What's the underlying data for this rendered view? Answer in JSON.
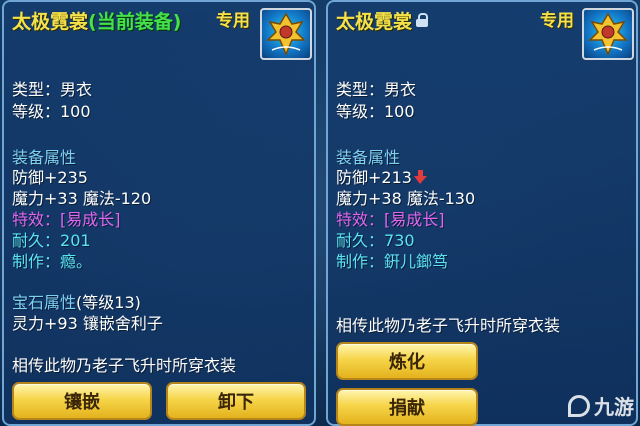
{
  "left": {
    "title": "太极霓裳",
    "title_suffix": "(当前装备)",
    "exclusive": "专用",
    "type_line": "类型：男衣",
    "level_line": "等级：100",
    "attr_header": "装备属性",
    "defense": "防御+235",
    "magic": "魔力+33 魔法-120",
    "effect_label": "特效：",
    "effect_value": "[易成长]",
    "durability_label": "耐久：",
    "durability_value": "201",
    "maker_label": "制作：",
    "maker_value": "瘾。",
    "gem_header": "宝石属性",
    "gem_level": "(等级13)",
    "gem_line": "灵力+93 镶嵌舍利子",
    "description": "相传此物乃老子飞升时所穿衣装",
    "buttons": {
      "inlay": "镶嵌",
      "unequip": "卸下"
    }
  },
  "right": {
    "title": "太极霓裳",
    "exclusive": "专用",
    "type_line": "类型：男衣",
    "level_line": "等级：100",
    "attr_header": "装备属性",
    "defense": "防御+213",
    "magic": "魔力+38 魔法-130",
    "effect_label": "特效：",
    "effect_value": "[易成长]",
    "durability_label": "耐久：",
    "durability_value": "730",
    "maker_label": "制作：",
    "maker_value": "銒儿鎯笃",
    "description": "相传此物乃老子飞升时所穿衣装",
    "buttons": {
      "refine": "炼化",
      "donate": "捐献"
    }
  },
  "watermark": "九游",
  "colors": {
    "title": "#f5e14a",
    "current_tag": "#46e04a",
    "section": "#7fd0f2",
    "effect": "#e066f0",
    "durability_maker": "#5ae3f5",
    "decrease_arrow": "#e23b3b",
    "button": "#f6d54a"
  },
  "icons": [
    "lock-icon",
    "equipment-item-icon",
    "down-arrow-icon",
    "jiuyou-logo-icon"
  ]
}
